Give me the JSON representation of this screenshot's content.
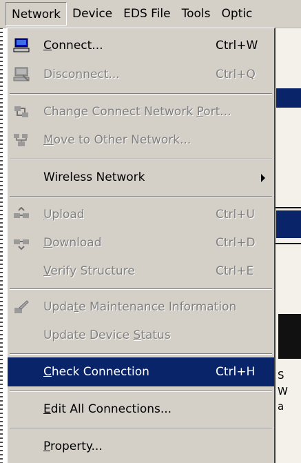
{
  "menubar": {
    "items": [
      {
        "label": "Network",
        "active": true
      },
      {
        "label": "Device"
      },
      {
        "label": "EDS File"
      },
      {
        "label": "Tools"
      },
      {
        "label": "Optic"
      }
    ]
  },
  "menu": {
    "items": [
      {
        "pre": "",
        "u": "C",
        "post": "onnect...",
        "shortcut": "Ctrl+W",
        "icon": "computer-connect-icon",
        "enabled": true
      },
      {
        "pre": "Disco",
        "u": "n",
        "post": "nect...",
        "shortcut": "Ctrl+Q",
        "icon": "computer-disconnect-icon",
        "enabled": false
      },
      {
        "pre": "Change Connect Network ",
        "u": "P",
        "post": "ort...",
        "shortcut": "",
        "icon": "network-port-icon",
        "enabled": false
      },
      {
        "pre": "",
        "u": "M",
        "post": "ove to Other Network...",
        "shortcut": "",
        "icon": "move-network-icon",
        "enabled": false
      },
      {
        "pre": "Wireless Network",
        "u": "",
        "post": "",
        "shortcut": "",
        "icon": "",
        "enabled": true,
        "submenu": true
      },
      {
        "pre": "",
        "u": "U",
        "post": "pload",
        "shortcut": "Ctrl+U",
        "icon": "upload-icon",
        "enabled": false
      },
      {
        "pre": "",
        "u": "D",
        "post": "ownload",
        "shortcut": "Ctrl+D",
        "icon": "download-icon",
        "enabled": false
      },
      {
        "pre": "",
        "u": "V",
        "post": "erify Structure",
        "shortcut": "Ctrl+E",
        "icon": "",
        "enabled": false
      },
      {
        "pre": "Upda",
        "u": "t",
        "post": "e Maintenance Information",
        "shortcut": "",
        "icon": "maintenance-icon",
        "enabled": false
      },
      {
        "pre": "Update Device ",
        "u": "S",
        "post": "tatus",
        "shortcut": "",
        "icon": "",
        "enabled": false
      },
      {
        "pre": "",
        "u": "C",
        "post": "heck Connection",
        "shortcut": "Ctrl+H",
        "icon": "",
        "enabled": true,
        "selected": true
      },
      {
        "pre": "",
        "u": "E",
        "post": "dit All Connections...",
        "shortcut": "",
        "icon": "",
        "enabled": true
      },
      {
        "pre": "",
        "u": "P",
        "post": "roperty...",
        "shortcut": "",
        "icon": "",
        "enabled": true
      }
    ]
  },
  "background": {
    "fragments": [
      "S",
      "W",
      "a"
    ]
  }
}
